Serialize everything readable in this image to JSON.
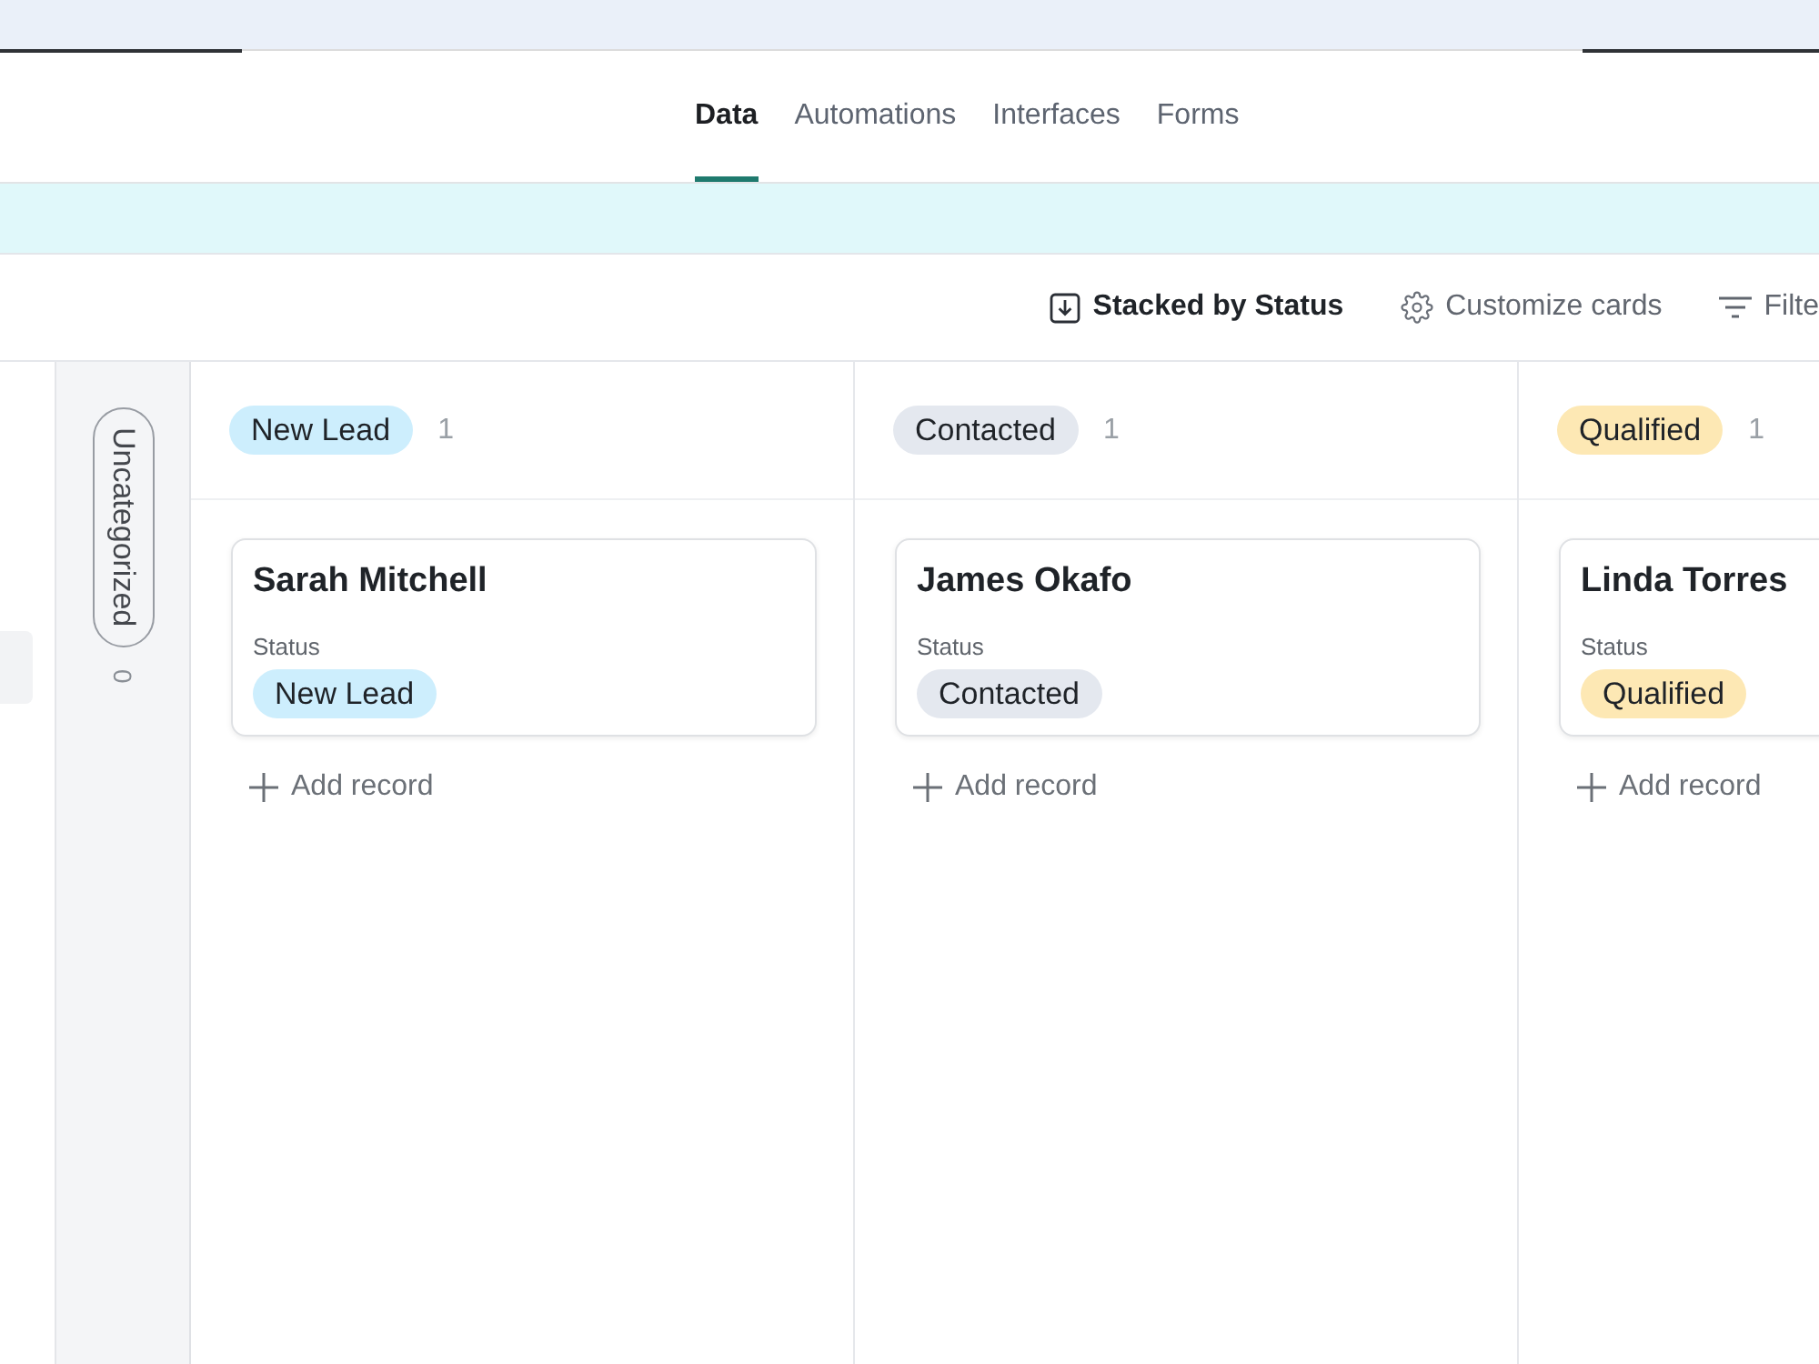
{
  "tabs": [
    {
      "label": "Data",
      "selected": true
    },
    {
      "label": "Automations",
      "selected": false
    },
    {
      "label": "Interfaces",
      "selected": false
    },
    {
      "label": "Forms",
      "selected": false
    }
  ],
  "toolbar": [
    {
      "kind": "stack",
      "label": "Stacked by Status"
    },
    {
      "kind": "customize",
      "label": "Customize cards"
    },
    {
      "kind": "filter",
      "label": "Filte"
    }
  ],
  "board": {
    "collapsed": [
      {
        "label": "Uncategorized",
        "count": "0"
      }
    ],
    "columns": [
      {
        "title": "New Lead",
        "color": "#cdeefd",
        "count": "1",
        "cards": [
          {
            "title": "Sarah Mitchell",
            "fields": [
              {
                "label": "Status",
                "value": "New Lead",
                "color": "#cdeefd"
              }
            ]
          }
        ],
        "add_label": "Add record"
      },
      {
        "title": "Contacted",
        "color": "#e4e8ef",
        "count": "1",
        "cards": [
          {
            "title": "James Okafo",
            "fields": [
              {
                "label": "Status",
                "value": "Contacted",
                "color": "#e4e8ef"
              }
            ]
          }
        ],
        "add_label": "Add record"
      },
      {
        "title": "Qualified",
        "color": "#fde8b4",
        "count": "1",
        "cards": [
          {
            "title": "Linda Torres",
            "fields": [
              {
                "label": "Status",
                "value": "Qualified",
                "color": "#fde8b4"
              }
            ]
          }
        ],
        "add_label": "Add record"
      }
    ]
  }
}
